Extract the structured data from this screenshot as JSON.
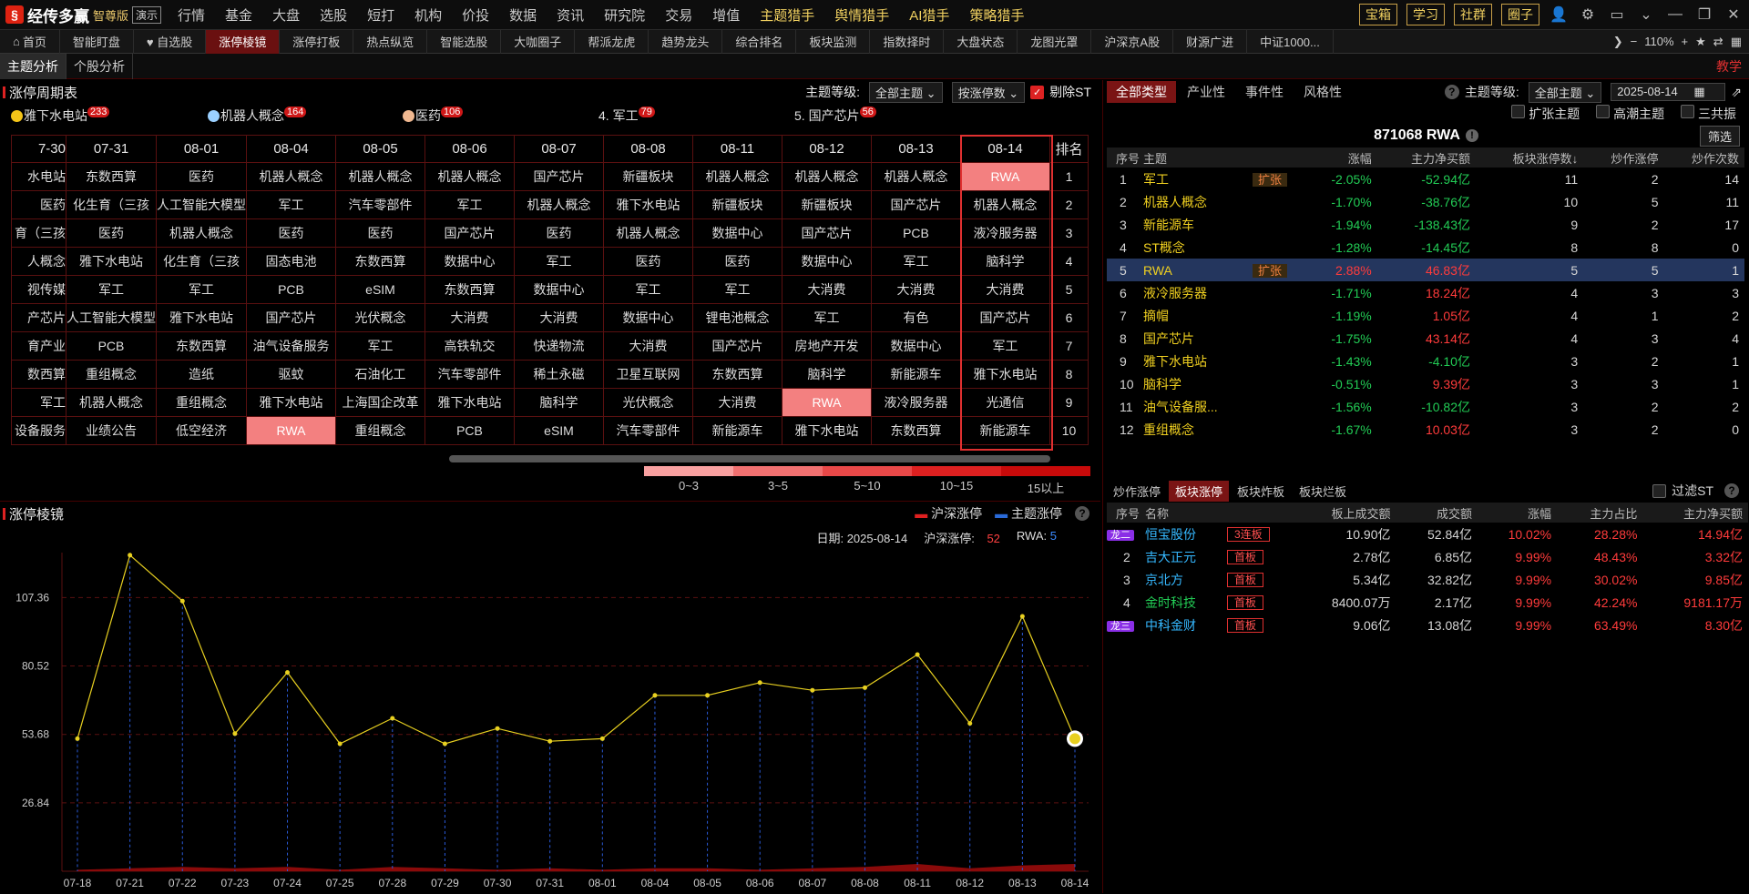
{
  "app": {
    "logo": "经传多赢",
    "edition": "智尊版",
    "demo": "演示"
  },
  "menu": [
    {
      "label": "行情"
    },
    {
      "label": "基金"
    },
    {
      "label": "大盘"
    },
    {
      "label": "选股"
    },
    {
      "label": "短打"
    },
    {
      "label": "机构"
    },
    {
      "label": "价投"
    },
    {
      "label": "数据"
    },
    {
      "label": "资讯"
    },
    {
      "label": "研究院"
    },
    {
      "label": "交易"
    },
    {
      "label": "增值"
    },
    {
      "label": "主题猎手",
      "hl": true
    },
    {
      "label": "舆情猎手",
      "hl": true
    },
    {
      "label": "AI猎手",
      "hl": true
    },
    {
      "label": "策略猎手",
      "hl": true
    }
  ],
  "topright": [
    "宝箱",
    "学习",
    "社群",
    "圈子"
  ],
  "tabs": [
    "首页",
    "智能盯盘",
    "♥ 自选股",
    "涨停棱镜",
    "涨停打板",
    "热点纵览",
    "智能选股",
    "大咖圈子",
    "帮派龙虎",
    "趋势龙头",
    "综合排名",
    "板块监测",
    "指数择时",
    "大盘状态",
    "龙图光罩",
    "沪深京A股",
    "财源广进",
    "中证1000..."
  ],
  "active_tab": "涨停棱镜",
  "zoom": "110%",
  "subtabs": [
    "主题分析",
    "个股分析"
  ],
  "teach": "教学",
  "cycle": {
    "title": "涨停周期表",
    "level_label": "主题等级:",
    "level_value": "全部主题",
    "sort_value": "按涨停数",
    "exclude_st": "剔除ST",
    "top": [
      {
        "label": "雅下水电站",
        "count": "233",
        "color": "#f5c518"
      },
      {
        "label": "机器人概念",
        "count": "164",
        "color": "#9ad0ff"
      },
      {
        "label": "医药",
        "count": "106",
        "color": "#f0b890"
      },
      {
        "label": "4. 军工",
        "count": "79"
      },
      {
        "label": "5. 国产芯片",
        "count": "56"
      }
    ],
    "dates": [
      "7-30",
      "07-31",
      "08-01",
      "08-04",
      "08-05",
      "08-06",
      "08-07",
      "08-08",
      "08-11",
      "08-12",
      "08-13",
      "08-14"
    ],
    "rank_header": "排名",
    "rows": [
      [
        "水电站",
        "东数西算",
        "医药",
        "机器人概念",
        "机器人概念",
        "机器人概念",
        "国产芯片",
        "新疆板块",
        "机器人概念",
        "机器人概念",
        "机器人概念",
        "RWA"
      ],
      [
        "医药",
        "化生育（三孩",
        "人工智能大模型",
        "军工",
        "汽车零部件",
        "军工",
        "机器人概念",
        "雅下水电站",
        "新疆板块",
        "新疆板块",
        "国产芯片",
        "机器人概念"
      ],
      [
        "育（三孩",
        "医药",
        "机器人概念",
        "医药",
        "医药",
        "国产芯片",
        "医药",
        "机器人概念",
        "数据中心",
        "国产芯片",
        "PCB",
        "液冷服务器"
      ],
      [
        "人概念",
        "雅下水电站",
        "化生育（三孩",
        "固态电池",
        "东数西算",
        "数据中心",
        "军工",
        "医药",
        "医药",
        "数据中心",
        "军工",
        "脑科学"
      ],
      [
        "视传媒",
        "军工",
        "军工",
        "PCB",
        "eSIM",
        "东数西算",
        "数据中心",
        "军工",
        "军工",
        "大消费",
        "大消费",
        "大消费"
      ],
      [
        "产芯片",
        "人工智能大模型",
        "雅下水电站",
        "国产芯片",
        "光伏概念",
        "大消费",
        "大消费",
        "数据中心",
        "锂电池概念",
        "军工",
        "有色",
        "国产芯片"
      ],
      [
        "育产业",
        "PCB",
        "东数西算",
        "油气设备服务",
        "军工",
        "高铁轨交",
        "快递物流",
        "大消费",
        "国产芯片",
        "房地产开发",
        "数据中心",
        "军工"
      ],
      [
        "数西算",
        "重组概念",
        "造纸",
        "驱蚊",
        "石油化工",
        "汽车零部件",
        "稀土永磁",
        "卫星互联网",
        "东数西算",
        "脑科学",
        "新能源车",
        "雅下水电站"
      ],
      [
        "军工",
        "机器人概念",
        "重组概念",
        "雅下水电站",
        "上海国企改革",
        "雅下水电站",
        "脑科学",
        "光伏概念",
        "大消费",
        "RWA",
        "液冷服务器",
        "光通信"
      ],
      [
        "设备服务",
        "业绩公告",
        "低空经济",
        "RWA",
        "重组概念",
        "PCB",
        "eSIM",
        "汽车零部件",
        "新能源车",
        "雅下水电站",
        "东数西算",
        "新能源车"
      ]
    ],
    "ranks": [
      "1",
      "2",
      "3",
      "4",
      "5",
      "6",
      "7",
      "8",
      "9",
      "10"
    ],
    "legend": [
      {
        "label": "0~3",
        "color": "#f8a0a0"
      },
      {
        "label": "3~5",
        "color": "#f07070"
      },
      {
        "label": "5~10",
        "color": "#e84848"
      },
      {
        "label": "10~15",
        "color": "#dd2020"
      },
      {
        "label": "15以上",
        "color": "#c80a0a"
      }
    ]
  },
  "prism": {
    "title": "涨停棱镜",
    "legend_a": "沪深涨停",
    "legend_b": "主题涨停",
    "date_label": "日期:",
    "date": "2025-08-14",
    "hs_label": "沪深涨停:",
    "hs_value": "52",
    "rwa_label": "RWA:",
    "rwa_value": "5"
  },
  "chart_data": {
    "type": "line",
    "x": [
      "07-18",
      "07-21",
      "07-22",
      "07-23",
      "07-24",
      "07-25",
      "07-28",
      "07-29",
      "07-30",
      "07-31",
      "08-01",
      "08-04",
      "08-05",
      "08-06",
      "08-07",
      "08-08",
      "08-11",
      "08-12",
      "08-13",
      "08-14"
    ],
    "series": [
      {
        "name": "沪深涨停",
        "values": [
          52,
          124,
          106,
          54,
          78,
          50,
          60,
          50,
          56,
          51,
          52,
          69,
          69,
          74,
          71,
          72,
          85,
          58,
          100,
          52
        ]
      },
      {
        "name": "主题涨停",
        "values": [
          1,
          2,
          3,
          2,
          3,
          1,
          3,
          2,
          1,
          2,
          1,
          2,
          2,
          1,
          2,
          3,
          5,
          2,
          4,
          5
        ]
      }
    ],
    "yticks": [
      26.84,
      53.68,
      80.52,
      107.36
    ],
    "ylim": [
      0,
      125
    ]
  },
  "right": {
    "types": [
      "全部类型",
      "产业性",
      "事件性",
      "风格性"
    ],
    "level_label": "主题等级:",
    "level_value": "全部主题",
    "date": "2025-08-14",
    "checks": [
      "扩张主题",
      "高潮主题",
      "三共振"
    ],
    "stock_title": "871068 RWA",
    "filter_btn": "筛选",
    "headers": [
      "序号",
      "主题",
      "",
      "涨幅",
      "主力净买额",
      "板块涨停数↓",
      "炒作涨停",
      "炒作次数"
    ],
    "rows": [
      [
        "1",
        "军工",
        "扩张",
        "-2.05%",
        "-52.94亿",
        "11",
        "2",
        "14"
      ],
      [
        "2",
        "机器人概念",
        "",
        "-1.70%",
        "-38.76亿",
        "10",
        "5",
        "11"
      ],
      [
        "3",
        "新能源车",
        "",
        "-1.94%",
        "-138.43亿",
        "9",
        "2",
        "17"
      ],
      [
        "4",
        "ST概念",
        "",
        "-1.28%",
        "-14.45亿",
        "8",
        "8",
        "0"
      ],
      [
        "5",
        "RWA",
        "扩张",
        "2.88%",
        "46.83亿",
        "5",
        "5",
        "1"
      ],
      [
        "6",
        "液冷服务器",
        "",
        "-1.71%",
        "18.24亿",
        "4",
        "3",
        "3"
      ],
      [
        "7",
        "摘帽",
        "",
        "-1.19%",
        "1.05亿",
        "4",
        "1",
        "2"
      ],
      [
        "8",
        "国产芯片",
        "",
        "-1.75%",
        "43.14亿",
        "4",
        "3",
        "4"
      ],
      [
        "9",
        "雅下水电站",
        "",
        "-1.43%",
        "-4.10亿",
        "3",
        "2",
        "1"
      ],
      [
        "10",
        "脑科学",
        "",
        "-0.51%",
        "9.39亿",
        "3",
        "3",
        "1"
      ],
      [
        "11",
        "油气设备服...",
        "",
        "-1.56%",
        "-10.82亿",
        "3",
        "2",
        "2"
      ],
      [
        "12",
        "重组概念",
        "",
        "-1.67%",
        "10.03亿",
        "3",
        "2",
        "0"
      ]
    ],
    "btabs": [
      "炒作涨停",
      "板块涨停",
      "板块炸板",
      "板块烂板"
    ],
    "filter_st": "过滤ST",
    "bheaders": [
      "序号",
      "名称",
      "",
      "板上成交额",
      "成交额",
      "涨幅",
      "主力占比",
      "主力净买额"
    ],
    "brows": [
      [
        "龙二",
        "恒宝股份",
        "3连板",
        "10.90亿",
        "52.84亿",
        "10.02%",
        "28.28%",
        "14.94亿"
      ],
      [
        "2",
        "吉大正元",
        "首板",
        "2.78亿",
        "6.85亿",
        "9.99%",
        "48.43%",
        "3.32亿"
      ],
      [
        "3",
        "京北方",
        "首板",
        "5.34亿",
        "32.82亿",
        "9.99%",
        "30.02%",
        "9.85亿"
      ],
      [
        "4",
        "金时科技",
        "首板",
        "8400.07万",
        "2.17亿",
        "9.99%",
        "42.24%",
        "9181.17万"
      ],
      [
        "龙三",
        "中科金财",
        "首板",
        "9.06亿",
        "13.08亿",
        "9.99%",
        "63.49%",
        "8.30亿"
      ]
    ]
  }
}
